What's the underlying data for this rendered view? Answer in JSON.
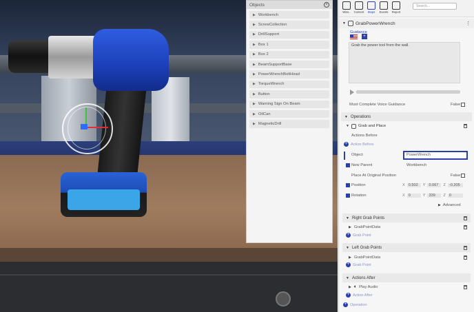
{
  "objects_panel": {
    "title": "Objects",
    "items": [
      "Workbench",
      "ScrewCollection",
      "DrillSupport",
      "Box 1",
      "Box 2",
      "BeamSupportBase",
      "PowerWrenchBoltHead",
      "TorqueWrench",
      "Button",
      "Warning Sign On Beam",
      "OilCan",
      "MagneticDrill"
    ]
  },
  "toolbar": {
    "tools": [
      "Wiss..",
      "Content",
      "Steps",
      "Events",
      "Report"
    ],
    "active": "Steps",
    "search_placeholder": "Search..."
  },
  "step": {
    "title": "GrabPowerWrench",
    "guidance_label": "Guidance",
    "guidance_text": "Grab the power tool from the wall.",
    "must_complete_label": "Must Complete Voice Guidance",
    "must_complete_value": "False"
  },
  "operations": {
    "section_label": "Operations",
    "grab_label": "Grab and Place",
    "actions_before_label": "Actions Before",
    "add_action_before": "Action Before",
    "object_label": "Object",
    "object_value": "PowerWrench",
    "new_parent_label": "New Parent",
    "new_parent_value": "Workbench",
    "place_original_label": "Place At Original Position",
    "place_original_value": "False",
    "position_label": "Position",
    "position": {
      "x": "0.502",
      "y": "0.067",
      "z": "-0.205"
    },
    "rotation_label": "Rotation",
    "rotation": {
      "x": "0",
      "y": "339",
      "z": "0"
    },
    "advanced_label": "Advanced",
    "right_grab_label": "Right Grab Points",
    "right_grab_item": "GrabPointData",
    "add_grab_point": "Grab Point",
    "left_grab_label": "Left Grab Points",
    "left_grab_item": "GrabPointData",
    "actions_after_label": "Actions After",
    "play_audio_label": "Play Audio",
    "add_action_after": "Action After",
    "add_operation": "Operation"
  },
  "colors": {
    "accent": "#2b3fa8",
    "panel_bg": "#f6f6f6"
  }
}
